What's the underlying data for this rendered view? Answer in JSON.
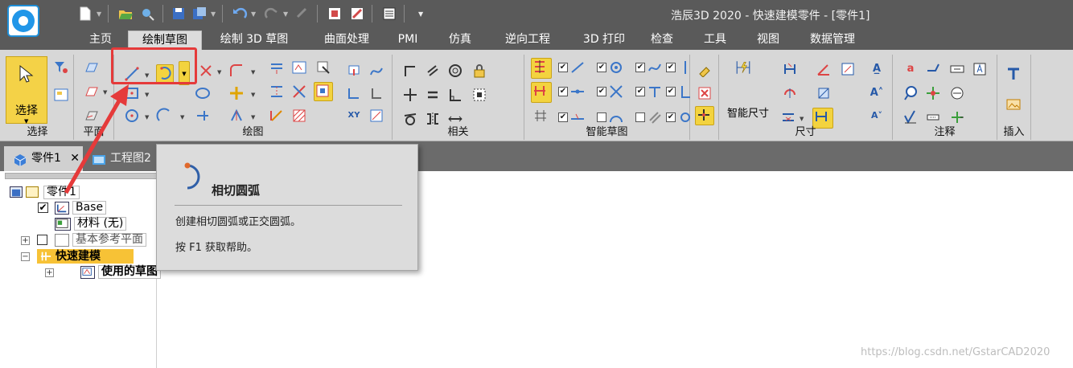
{
  "window": {
    "title": "浩辰3D 2020 - 快速建模零件 - [零件1]"
  },
  "menu_tabs": [
    {
      "label": "主页"
    },
    {
      "label": "绘制草图"
    },
    {
      "label": "绘制 3D 草图"
    },
    {
      "label": "曲面处理"
    },
    {
      "label": "PMI"
    },
    {
      "label": "仿真"
    },
    {
      "label": "逆向工程"
    },
    {
      "label": "3D 打印"
    },
    {
      "label": "检查"
    },
    {
      "label": "工具"
    },
    {
      "label": "视图"
    },
    {
      "label": "数据管理"
    }
  ],
  "active_menu_tab": "绘制草图",
  "ribbon": {
    "select_button_label": "选择",
    "groups": [
      {
        "label": "选择"
      },
      {
        "label": "平面"
      },
      {
        "label": "绘图"
      },
      {
        "label": "相关"
      },
      {
        "label": "智能草图"
      },
      {
        "label": "尺寸"
      },
      {
        "label": "注释"
      },
      {
        "label": "插入"
      }
    ],
    "smart_dimension_label": "智能尺寸",
    "xy_label": "XY"
  },
  "doc_tabs": [
    {
      "label": "零件1",
      "close": "✕"
    },
    {
      "label": "工程图2"
    }
  ],
  "tree": {
    "root": "零件1",
    "base": "Base",
    "material": "材料 (无)",
    "ref_planes": "基本参考平面",
    "quick_model": "快速建模",
    "used_sketch": "使用的草图"
  },
  "tooltip": {
    "title": "相切圆弧",
    "description": "创建相切圆弧或正交圆弧。",
    "help": "按 F1 获取帮助。"
  },
  "watermark": "https://blog.csdn.net/GstarCAD2020",
  "colors": {
    "titlebar": "#5a5a5a",
    "ribbon": "#d7d7d7",
    "highlight": "#f3d33f",
    "annotation_red": "#e53a3a",
    "tooltip_bg": "#dcdcdc"
  }
}
